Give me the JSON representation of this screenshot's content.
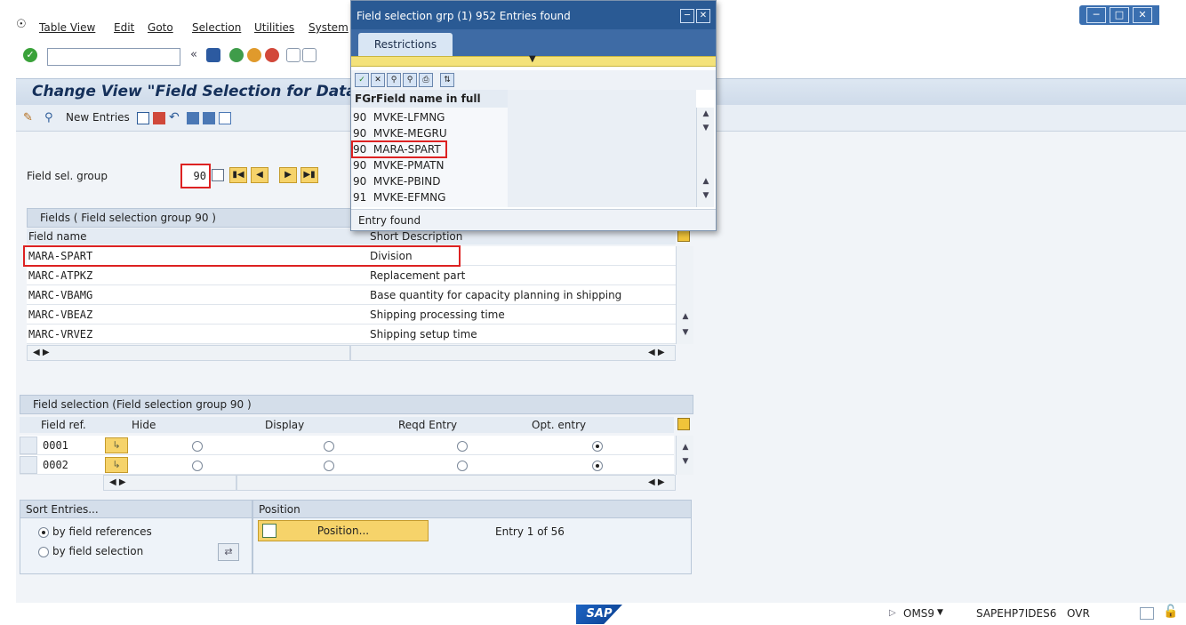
{
  "menu": {
    "items": [
      "Table View",
      "Edit",
      "Goto",
      "Selection",
      "Utilities",
      "System"
    ]
  },
  "page": {
    "title": "Change View \"Field Selection for Data"
  },
  "appbar": {
    "new_entries": "New Entries"
  },
  "field_sel_group": {
    "label": "Field sel. group",
    "value": "90"
  },
  "fields_table": {
    "group_title": "Fields ( Field selection group 90 )",
    "columns": [
      "Field name",
      "Short Description"
    ],
    "rows": [
      {
        "field": "MARA-SPART",
        "desc": "Division"
      },
      {
        "field": "MARC-ATPKZ",
        "desc": "Replacement part"
      },
      {
        "field": "MARC-VBAMG",
        "desc": "Base quantity for capacity planning in shipping"
      },
      {
        "field": "MARC-VBEAZ",
        "desc": "Shipping processing time"
      },
      {
        "field": "MARC-VRVEZ",
        "desc": "Shipping setup time"
      }
    ]
  },
  "field_selection": {
    "group_title": "Field selection (Field selection group 90 )",
    "columns": [
      "Field ref.",
      "Hide",
      "Display",
      "Reqd Entry",
      "Opt. entry"
    ],
    "rows": [
      {
        "ref": "0001",
        "selected": "opt"
      },
      {
        "ref": "0002",
        "selected": "opt"
      }
    ]
  },
  "sort": {
    "title": "Sort Entries...",
    "by_refs": "by field references",
    "by_selection": "by field selection"
  },
  "position": {
    "title": "Position",
    "button": "Position...",
    "entry_info": "Entry 1 of 56"
  },
  "popup": {
    "title": "Field selection grp (1)  952 Entries found",
    "tab": "Restrictions",
    "col_fgr": "FGr",
    "col_name": "Field name in full",
    "rows": [
      {
        "fgr": "90",
        "name": "MVKE-LFMNG"
      },
      {
        "fgr": "90",
        "name": "MVKE-MEGRU"
      },
      {
        "fgr": "90",
        "name": "MARA-SPART"
      },
      {
        "fgr": "90",
        "name": "MVKE-PMATN"
      },
      {
        "fgr": "90",
        "name": "MVKE-PBIND"
      },
      {
        "fgr": "91",
        "name": "MVKE-EFMNG"
      }
    ],
    "status": "Entry found"
  },
  "footer": {
    "sap": "SAP",
    "transaction": "OMS9",
    "system": "SAPEHP7IDES6",
    "mode": "OVR"
  },
  "colors": {
    "highlight": "#d22222",
    "button_yellow": "#f6d36a",
    "popup_blue": "#2a5a94"
  }
}
